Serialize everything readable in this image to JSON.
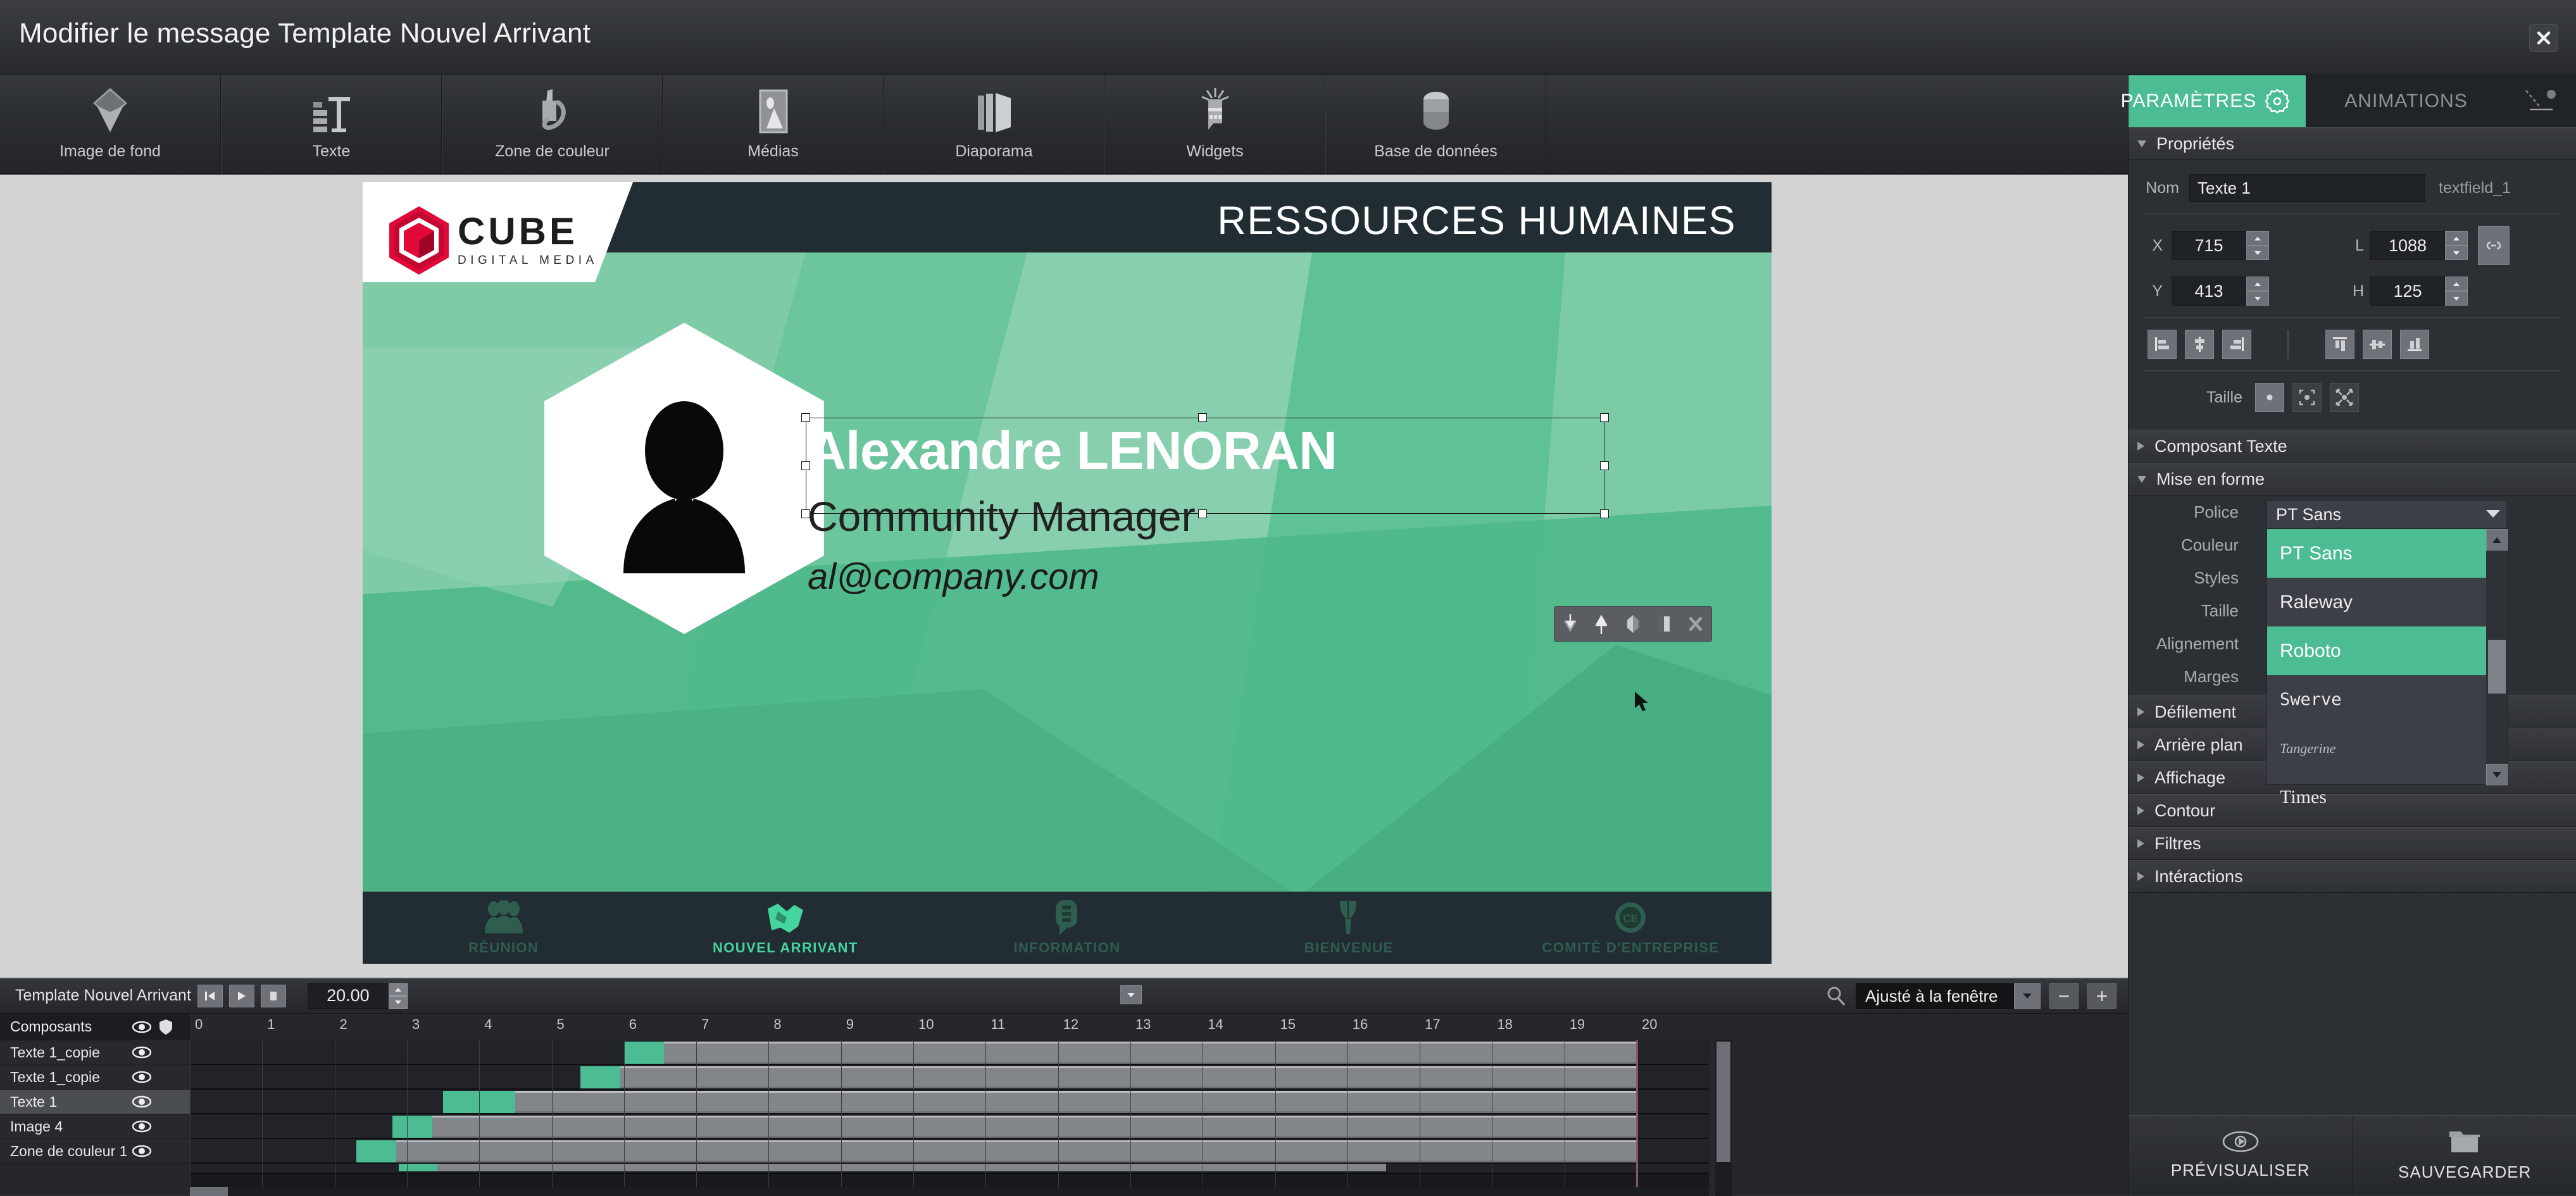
{
  "window": {
    "title": "Modifier le message Template Nouvel Arrivant",
    "close_label": "×"
  },
  "toolbar": {
    "items": [
      {
        "label": "Image de fond",
        "icon": "background-image-icon"
      },
      {
        "label": "Texte",
        "icon": "text-icon"
      },
      {
        "label": "Zone de couleur",
        "icon": "color-zone-icon"
      },
      {
        "label": "Médias",
        "icon": "media-icon"
      },
      {
        "label": "Diaporama",
        "icon": "slideshow-icon"
      },
      {
        "label": "Widgets",
        "icon": "widgets-icon"
      },
      {
        "label": "Base de données",
        "icon": "database-icon"
      }
    ]
  },
  "slide": {
    "brand": {
      "name": "CUBE",
      "tagline": "DIGITAL MEDIA"
    },
    "header_title": "RESSOURCES HUMAINES",
    "person": {
      "name": "Alexandre LENORAN",
      "role": "Community Manager",
      "email": "al@company.com"
    },
    "nav": [
      {
        "label": "RÉUNION",
        "icon": "people-group-icon",
        "active": false
      },
      {
        "label": "NOUVEL ARRIVANT",
        "icon": "handshake-icon",
        "active": true
      },
      {
        "label": "INFORMATION",
        "icon": "speech-bubble-icon",
        "active": false
      },
      {
        "label": "BIENVENUE",
        "icon": "tulip-icon",
        "active": false
      },
      {
        "label": "COMITÉ D'ENTREPRISE",
        "icon": "ce-badge-icon",
        "active": false
      }
    ],
    "mini_toolbar": [
      {
        "icon": "send-backward-icon"
      },
      {
        "icon": "bring-forward-icon"
      },
      {
        "icon": "mask-icon"
      },
      {
        "icon": "duplicate-icon"
      },
      {
        "icon": "delete-icon"
      }
    ]
  },
  "timeline": {
    "project_name": "Template Nouvel Arrivant",
    "duration": "20.00",
    "transport": [
      {
        "icon": "skip-to-start-icon"
      },
      {
        "icon": "play-icon"
      },
      {
        "icon": "stop-icon"
      }
    ],
    "components_header": "Composants",
    "header_icons": [
      "eye-icon",
      "lock-shield-icon"
    ],
    "layers": [
      {
        "label": "Texte 1_copie",
        "visible_icon": "eye-icon",
        "selected": false,
        "start": 6.0
      },
      {
        "label": "Texte 1_copie",
        "visible_icon": "eye-icon",
        "selected": false,
        "start": 5.4
      },
      {
        "label": "Texte 1",
        "visible_icon": "eye-icon",
        "selected": true,
        "start": 3.5
      },
      {
        "label": "Image 4",
        "visible_icon": "eye-icon",
        "selected": false,
        "start": 2.8
      },
      {
        "label": "Zone de couleur 1",
        "visible_icon": "eye-icon",
        "selected": false,
        "start": 2.3
      }
    ],
    "ruler_ticks": [
      "0",
      "1",
      "2",
      "3",
      "4",
      "5",
      "6",
      "7",
      "8",
      "9",
      "10",
      "11",
      "12",
      "13",
      "14",
      "15",
      "16",
      "17",
      "18",
      "19",
      "20"
    ],
    "zoom": {
      "icon": "magnifier-icon",
      "value": "Ajusté à la fenêtre",
      "minus": "−",
      "plus": "+"
    }
  },
  "panel": {
    "tabs": {
      "parameters": "PARAMÈTRES",
      "gear_icon": "gear-icon",
      "animations": "ANIMATIONS",
      "anim_icon": "motion-path-icon"
    },
    "sections": {
      "properties": {
        "label": "Propriétés",
        "open": true
      },
      "composant_texte": {
        "label": "Composant Texte",
        "open": false
      },
      "mise_en_forme": {
        "label": "Mise en forme",
        "open": true
      },
      "defilement": {
        "label": "Défilement",
        "open": false
      },
      "arriere_plan": {
        "label": "Arrière plan",
        "open": false
      },
      "affichage": {
        "label": "Affichage",
        "open": false
      },
      "contour": {
        "label": "Contour",
        "open": false
      },
      "filtres": {
        "label": "Filtres",
        "open": false
      },
      "interactions": {
        "label": "Intéractions",
        "open": false
      }
    },
    "properties": {
      "nom_label": "Nom",
      "nom_value": "Texte 1",
      "type_id": "textfield_1",
      "x_label": "X",
      "x_value": "715",
      "y_label": "Y",
      "y_value": "413",
      "l_label": "L",
      "l_value": "1088",
      "h_label": "H",
      "h_value": "125",
      "link_icon": "link-ratio-icon",
      "align_icons": [
        "align-left-icon",
        "align-center-h-icon",
        "align-right-icon",
        "align-top-icon",
        "align-center-v-icon",
        "align-bottom-icon"
      ],
      "taille_label": "Taille",
      "taille_icons": [
        "size-original-icon",
        "size-fit-icon",
        "size-fill-icon"
      ]
    },
    "mise_en_forme": {
      "police_label": "Police",
      "police_value": "PT Sans",
      "couleur_label": "Couleur",
      "styles_label": "Styles",
      "taille_label": "Taille",
      "alignement_label": "Alignement",
      "marges_label": "Marges",
      "font_options": [
        {
          "name": "PT Sans",
          "selected": true
        },
        {
          "name": "Raleway",
          "selected": false
        },
        {
          "name": "Roboto",
          "selected": true
        },
        {
          "name": "Swerve",
          "selected": false
        },
        {
          "name": "Tangerine",
          "selected": false
        },
        {
          "name": "Times",
          "selected": false
        }
      ]
    },
    "footer": {
      "preview_label": "PRÉVISUALISER",
      "preview_icon": "eye-preview-icon",
      "save_label": "SAUVEGARDER",
      "save_icon": "folder-save-icon"
    }
  },
  "colors": {
    "accent": "#4CBD93",
    "slide_green": "#4FB98C",
    "slide_dark": "#222c33",
    "brand_red": "#E1093A"
  }
}
